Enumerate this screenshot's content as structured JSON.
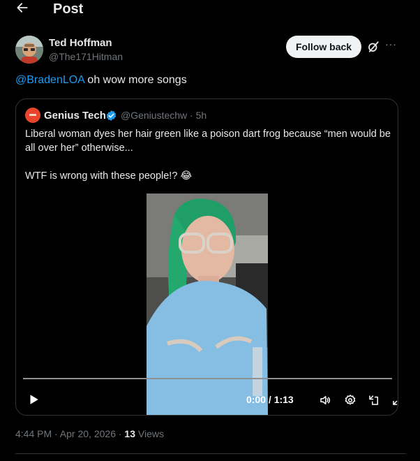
{
  "header": {
    "title": "Post",
    "back_icon": "arrow-left-icon"
  },
  "author": {
    "name": "Ted Hoffman",
    "handle": "@The171Hitman",
    "follow_label": "Follow back"
  },
  "tweet": {
    "mention": "@BradenLOA",
    "text": " oh wow more songs"
  },
  "quote": {
    "name": "Genius Tech",
    "handle": "@Geniustechw · 5h",
    "text_line1": "Liberal woman dyes her hair green like a poison dart frog because “men would be all over her” otherwise...",
    "text_line2": "WTF is wrong with these people!? 😂",
    "verified_color": "#1d9bf0"
  },
  "video": {
    "time": "0:00 / 1:13",
    "controls": [
      "play-icon",
      "volume-icon",
      "settings-gear-icon",
      "picture-in-picture-icon",
      "fullscreen-icon"
    ]
  },
  "meta": {
    "timestamp": "4:44 PM · Apr 20, 2026 · ",
    "views_count": "13",
    "views_label": " Views"
  },
  "colors": {
    "background": "#000000",
    "text": "#e7e9ea",
    "muted": "#71767b",
    "link": "#1d9bf0",
    "border": "#2f3336"
  }
}
